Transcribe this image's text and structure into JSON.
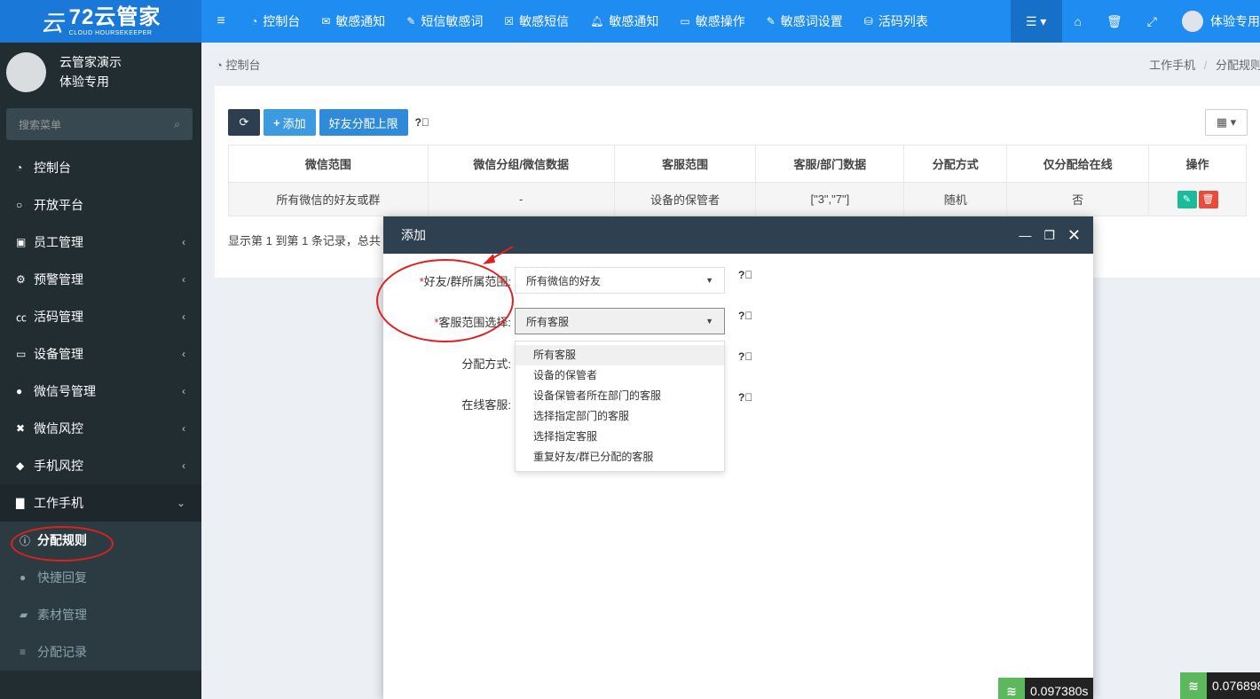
{
  "brand": {
    "name": "72云管家",
    "subtitle": "CLOUD HOURSEKEEPER",
    "mark": "云"
  },
  "topnav": {
    "items": [
      {
        "icon": "dashboard-icon",
        "label": "控制台"
      },
      {
        "icon": "envelope-icon",
        "label": "敏感通知"
      },
      {
        "icon": "pencil-icon",
        "label": "短信敏感词"
      },
      {
        "icon": "close-box-icon",
        "label": "敏感短信"
      },
      {
        "icon": "bell-icon",
        "label": "敏感通知"
      },
      {
        "icon": "card-icon",
        "label": "敏感操作"
      },
      {
        "icon": "pencil-icon",
        "label": "敏感词设置"
      },
      {
        "icon": "database-icon",
        "label": "活码列表"
      }
    ],
    "user_label": "体验专用"
  },
  "user_panel": {
    "name": "云管家演示",
    "role": "体验专用"
  },
  "search": {
    "placeholder": "搜索菜单"
  },
  "sidebar": {
    "items": [
      {
        "icon": "dashboard-icon",
        "label": "控制台",
        "has_arrow": false
      },
      {
        "icon": "circle-icon",
        "label": "开放平台",
        "has_arrow": false
      },
      {
        "icon": "id-card-icon",
        "label": "员工管理",
        "has_arrow": true
      },
      {
        "icon": "gear-icon",
        "label": "预警管理",
        "has_arrow": true
      },
      {
        "icon": "cc-icon",
        "label": "活码管理",
        "has_arrow": true
      },
      {
        "icon": "desktop-icon",
        "label": "设备管理",
        "has_arrow": true
      },
      {
        "icon": "wechat-icon",
        "label": "微信号管理",
        "has_arrow": true
      },
      {
        "icon": "shield-icon",
        "label": "微信风控",
        "has_arrow": true
      },
      {
        "icon": "android-icon",
        "label": "手机风控",
        "has_arrow": true
      }
    ],
    "open_item": {
      "icon": "briefcase-icon",
      "label": "工作手机"
    },
    "submenu": [
      {
        "icon": "info-icon",
        "label": "分配规则"
      },
      {
        "icon": "chat-icon",
        "label": "快捷回复"
      },
      {
        "icon": "folder-icon",
        "label": "素材管理"
      },
      {
        "icon": "list-icon",
        "label": "分配记录"
      }
    ]
  },
  "breadcrumb": {
    "home": "控制台",
    "path_1": "工作手机",
    "separator": "/",
    "path_2": "分配规则"
  },
  "toolbar": {
    "add_label": "添加",
    "limit_label": "好友分配上限"
  },
  "table": {
    "headers": [
      "微信范围",
      "微信分组/微信数据",
      "客服范围",
      "客服/部门数据",
      "分配方式",
      "仅分配给在线",
      "操作"
    ],
    "rows": [
      [
        "所有微信的好友或群",
        "-",
        "设备的保管者",
        "[\"3\",\"7\"]",
        "随机",
        "否"
      ]
    ]
  },
  "pagination": {
    "text": "显示第 1 到第 1 条记录，总共"
  },
  "modal": {
    "title": "添加",
    "fields": [
      {
        "label": "好友/群所属范围:",
        "required": true,
        "value": "所有微信的好友"
      },
      {
        "label": "客服范围选择:",
        "required": true,
        "value": "所有客服"
      },
      {
        "label": "分配方式:",
        "required": false,
        "value": ""
      },
      {
        "label": "在线客服:",
        "required": false,
        "value": ""
      }
    ],
    "dropdown_options": [
      "所有客服",
      "设备的保管者",
      "设备保管者所在部门的客服",
      "选择指定部门的客服",
      "选择指定客服",
      "重复好友/群已分配的客服"
    ]
  },
  "timers": [
    "0.097380s",
    "0.076898"
  ],
  "colors": {
    "topbar": "#1e8cf0",
    "sidebar": "#222d32",
    "modal_header": "#2f4050",
    "annotation": "#e02020"
  }
}
